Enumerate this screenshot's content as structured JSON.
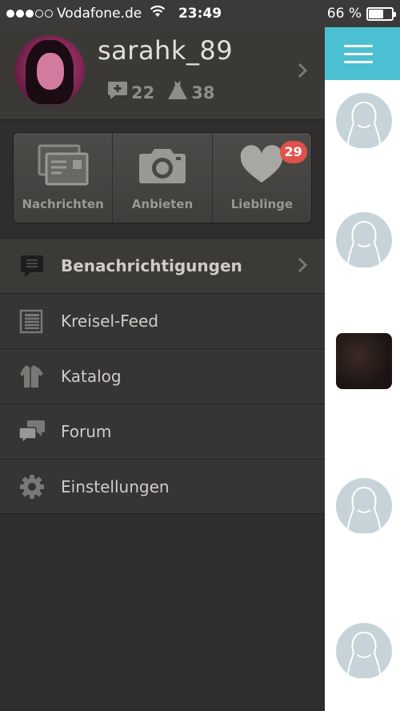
{
  "status_bar": {
    "carrier": "Vodafone.de",
    "time": "23:49",
    "battery": "66 %",
    "battery_level": 0.66,
    "signal_bars_filled": 3,
    "signal_bars_total": 5
  },
  "profile": {
    "username": "sarahk_89",
    "comments_count": "22",
    "items_count": "38"
  },
  "quick_actions": [
    {
      "label": "Nachrichten",
      "icon": "envelope-icon"
    },
    {
      "label": "Anbieten",
      "icon": "camera-icon"
    },
    {
      "label": "Lieblinge",
      "icon": "heart-icon",
      "badge": "29"
    }
  ],
  "menu": [
    {
      "label": "Benachrichtigungen",
      "icon": "notification-icon",
      "active": true
    },
    {
      "label": "Kreisel-Feed",
      "icon": "newspaper-icon"
    },
    {
      "label": "Katalog",
      "icon": "clothing-icon"
    },
    {
      "label": "Forum",
      "icon": "speech-bubbles-icon"
    },
    {
      "label": "Einstellungen",
      "icon": "gear-icon"
    }
  ],
  "colors": {
    "accent": "#4bc0d2",
    "badge": "#e0514b",
    "drawer_bg": "#2f2e2c"
  }
}
